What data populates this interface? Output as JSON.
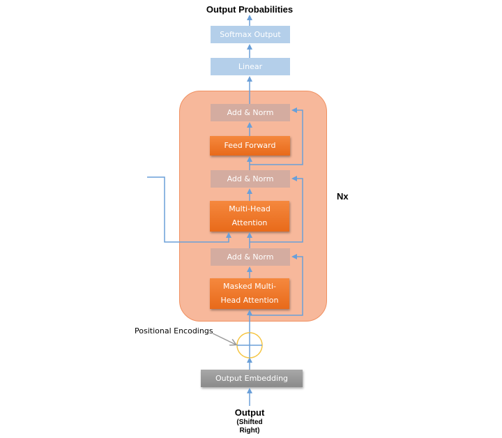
{
  "title": "Output Probabilities",
  "decoder": {
    "softmax": "Softmax Output",
    "linear": "Linear",
    "add_norm_top": "Add & Norm",
    "feed_forward": "Feed Forward",
    "add_norm_mid": "Add & Norm",
    "multi_head_attention": "Multi-Head Attention",
    "add_norm_bottom": "Add & Norm",
    "masked_multi_head_attention": "Masked Multi-Head Attention",
    "repeat_label": "Nx"
  },
  "positional_encodings": "Positional Encodings",
  "output_embedding": "Output Embedding",
  "input": {
    "label": "Output",
    "sublabel_line1": "(Shifted",
    "sublabel_line2": "Right)"
  },
  "colors": {
    "arrow": "#6a9fd8",
    "container": "#f7b89b",
    "orange_box": "#ef7a2c",
    "norm_box": "#d4aca0",
    "blue_box": "#b4cfea",
    "embedding_box": "#999999",
    "pe_circle": "#f5c542"
  }
}
